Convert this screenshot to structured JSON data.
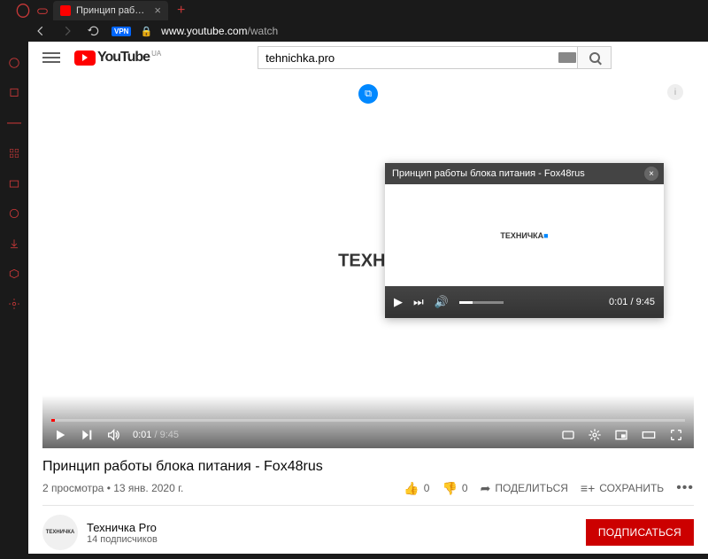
{
  "browser": {
    "tab_title": "Принцип работы блока п",
    "url_domain": "www.youtube.com",
    "url_path": "/watch",
    "vpn_label": "VPN"
  },
  "header": {
    "logo_text": "YouTube",
    "region": "UA",
    "search_value": "tehnichka.pro"
  },
  "player": {
    "video_text": "ТЕХНИ",
    "time_current": "0:01",
    "time_total": "9:45"
  },
  "pip": {
    "title": "Принцип работы блока питания - Fox48rus",
    "content_text": "ТЕХНИЧКА",
    "time_current": "0:01",
    "time_total": "9:45"
  },
  "video": {
    "title": "Принцип работы блока питания - Fox48rus",
    "views": "2 просмотра",
    "date": "13 янв. 2020 г.",
    "likes": "0",
    "dislikes": "0",
    "share_label": "ПОДЕЛИТЬСЯ",
    "save_label": "СОХРАНИТЬ"
  },
  "channel": {
    "avatar_text": "ТЕХНИЧКА",
    "name": "Техничка Pro",
    "subs": "14 подписчиков",
    "subscribe_label": "ПОДПИСАТЬСЯ"
  }
}
